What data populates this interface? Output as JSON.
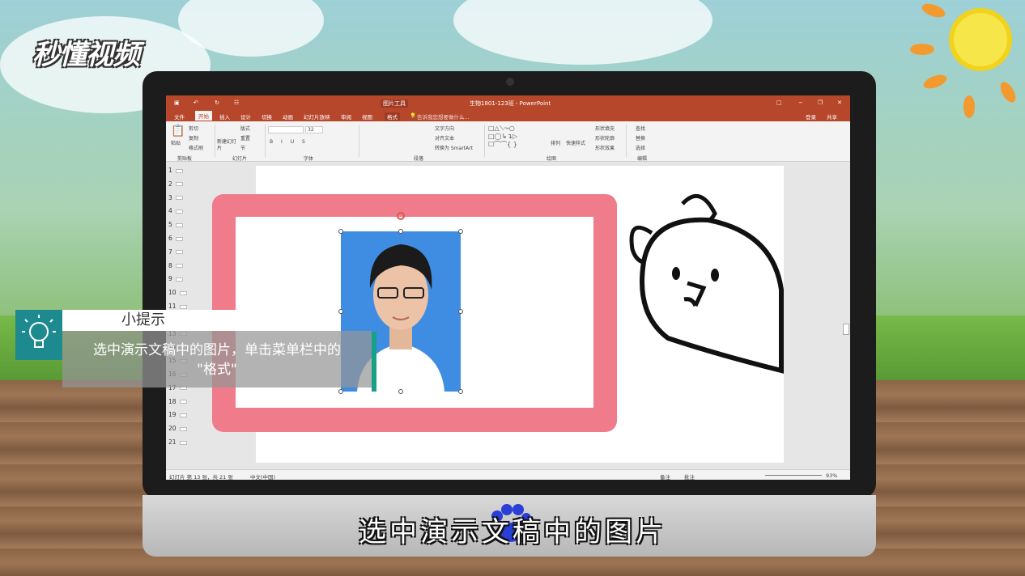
{
  "brand": {
    "logo_text": "秒懂视频"
  },
  "window": {
    "title": "生物1801-123班 - PowerPoint",
    "context_tab_group": "图片工具",
    "controls": [
      "□",
      "−",
      "❐",
      "✕"
    ]
  },
  "menu": {
    "tabs": [
      "文件",
      "开始",
      "插入",
      "设计",
      "切换",
      "动画",
      "幻灯片放映",
      "审阅",
      "视图",
      "格式"
    ],
    "active": "开始",
    "tell_me": "告诉我您想要做什么...",
    "login": "登录",
    "share": "共享"
  },
  "ribbon": {
    "clipboard": {
      "paste": "粘贴",
      "cut": "剪切",
      "copy": "复制",
      "format_painter": "格式刷",
      "group": "剪贴板"
    },
    "slides": {
      "new_slide": "新建幻灯片",
      "layout": "版式",
      "reset": "重置",
      "section": "节",
      "group": "幻灯片"
    },
    "font": {
      "size": "32",
      "group": "字体"
    },
    "paragraph": {
      "text_direction": "文字方向",
      "align_text": "对齐文本",
      "smartart": "转换为 SmartArt",
      "group": "段落"
    },
    "drawing": {
      "arrange": "排列",
      "quick_styles": "快速样式",
      "shape_fill": "形状填充",
      "shape_outline": "形状轮廓",
      "shape_effects": "形状效果",
      "group": "绘图"
    },
    "editing": {
      "find": "查找",
      "replace": "替换",
      "select": "选择",
      "group": "编辑"
    }
  },
  "thumbnails": [
    "1",
    "2",
    "3",
    "4",
    "5",
    "6",
    "7",
    "8",
    "9",
    "10",
    "11",
    "12",
    "13",
    "14",
    "15",
    "16",
    "17",
    "18",
    "19",
    "20",
    "21"
  ],
  "status": {
    "slide_info": "幻灯片 第 13 张，共 21 张",
    "language": "中文(中国)",
    "notes": "备注",
    "comments": "批注",
    "zoom": "93%"
  },
  "tip": {
    "heading": "小提示",
    "line1": "选中演示文稿中的图片，单击菜单栏中的",
    "line2": "\"格式\""
  },
  "subtitle": "选中演示文稿中的图片",
  "colors": {
    "ppt_red": "#b7472a",
    "frame_pink": "#f07b8a",
    "photo_blue": "#3f8de2",
    "tip_teal": "#1d8a8f"
  }
}
